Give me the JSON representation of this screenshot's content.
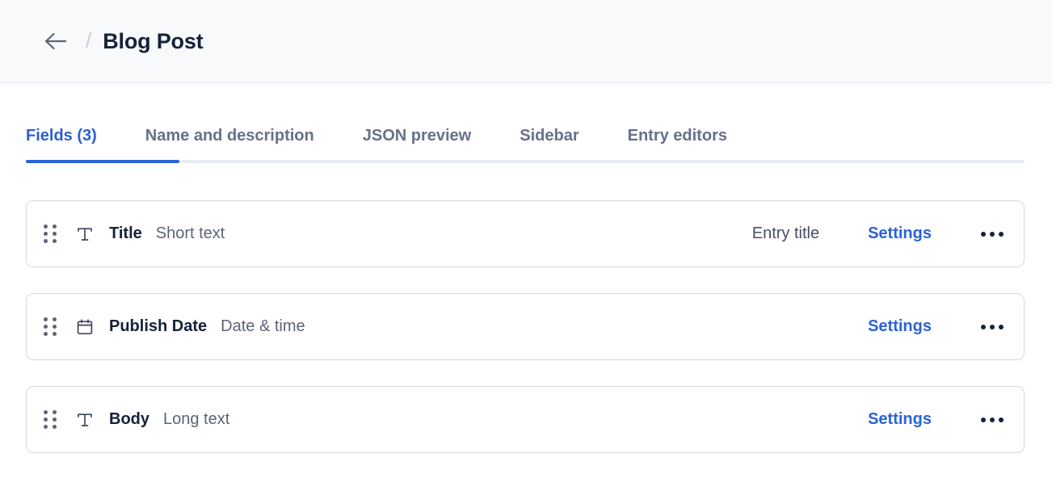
{
  "header": {
    "back_icon": "arrow-left-icon",
    "breadcrumb_separator": "/",
    "title": "Blog Post"
  },
  "tabs": [
    {
      "label": "Fields (3)",
      "active": true
    },
    {
      "label": "Name and description",
      "active": false
    },
    {
      "label": "JSON preview",
      "active": false
    },
    {
      "label": "Sidebar",
      "active": false
    },
    {
      "label": "Entry editors",
      "active": false
    }
  ],
  "colors": {
    "accent_blue": "#2a63d6",
    "active_tab_text": "#2e5fd0",
    "tab_text": "#68708a",
    "title_text": "#16213a",
    "type_text": "#5c6478",
    "card_border": "#d3d9e2",
    "header_bg": "#f7f9fa",
    "tab_track": "#e8ebef"
  },
  "fields": [
    {
      "drag_handle": "drag-handle-icon",
      "icon": "text-short-icon",
      "name": "Title",
      "type": "Short text",
      "badge": "Entry title",
      "settings_label": "Settings",
      "menu_icon": "more-horizontal-icon"
    },
    {
      "drag_handle": "drag-handle-icon",
      "icon": "calendar-icon",
      "name": "Publish Date",
      "type": "Date & time",
      "badge": "",
      "settings_label": "Settings",
      "menu_icon": "more-horizontal-icon"
    },
    {
      "drag_handle": "drag-handle-icon",
      "icon": "text-long-icon",
      "name": "Body",
      "type": "Long text",
      "badge": "",
      "settings_label": "Settings",
      "menu_icon": "more-horizontal-icon"
    }
  ]
}
